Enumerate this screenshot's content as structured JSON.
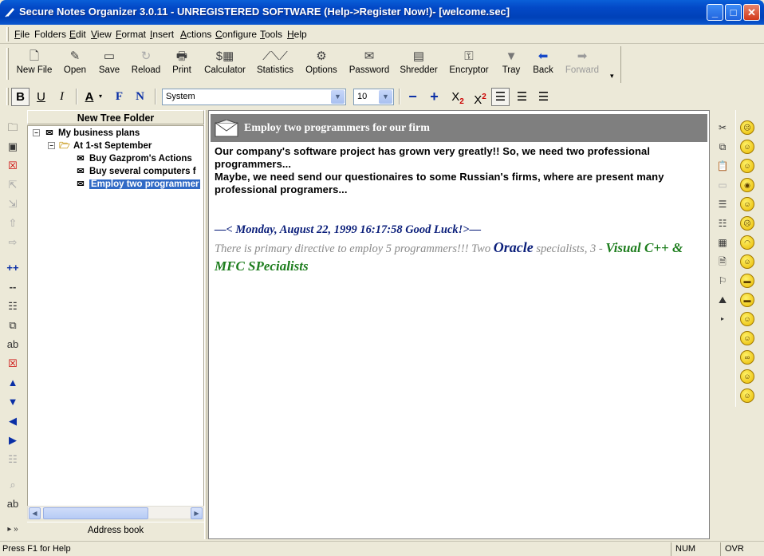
{
  "window": {
    "title": "Secure Notes Organizer 3.0.11 - UNREGISTERED SOFTWARE (Help->Register Now!)- [welcome.sec]",
    "min_label": "_",
    "max_label": "□",
    "close_label": "✕"
  },
  "menu": [
    {
      "label": "File",
      "u": "F",
      "rest": "ile"
    },
    {
      "label": "Folders",
      "u": "",
      "rest": "Folders"
    },
    {
      "label": "Edit",
      "u": "E",
      "rest": "dit"
    },
    {
      "label": "View",
      "u": "V",
      "rest": "iew"
    },
    {
      "label": "Format",
      "u": "F",
      "rest": "ormat"
    },
    {
      "label": "Insert",
      "u": "I",
      "rest": "nsert"
    },
    {
      "label": "Actions",
      "u": "A",
      "rest": "ctions"
    },
    {
      "label": "Configure",
      "u": "C",
      "rest": "onfigure"
    },
    {
      "label": "Tools",
      "u": "T",
      "rest": "ools"
    },
    {
      "label": "Help",
      "u": "H",
      "rest": "elp"
    }
  ],
  "toolbar": {
    "new_file": "New File",
    "open": "Open",
    "save": "Save",
    "reload": "Reload",
    "print": "Print",
    "calculator": "Calculator",
    "statistics": "Statistics",
    "options": "Options",
    "password": "Password",
    "shredder": "Shredder",
    "encryptor": "Encryptor",
    "tray": "Tray",
    "back": "Back",
    "forward": "Forward"
  },
  "format": {
    "bold": "B",
    "underline": "U",
    "italic": "I",
    "font_color": "A",
    "f_btn": "F",
    "n_btn": "N",
    "font_name": "System",
    "font_size": "10",
    "minus": "−",
    "plus": "+",
    "subscript": "X",
    "subscript_mark": "2",
    "superscript": "X",
    "superscript_mark": "2"
  },
  "tree": {
    "header": "New Tree Folder",
    "nodes": [
      {
        "label": "My business plans"
      },
      {
        "label": "At 1-st September"
      },
      {
        "label": "Buy Gazprom's Actions"
      },
      {
        "label": "Buy several computers f"
      },
      {
        "label": "Employ two programmer"
      }
    ],
    "footer": "Address book"
  },
  "note": {
    "title": "Employ two programmers for our firm",
    "para1": "Our company's software project has grown very greatly!! So, we need two professional programmers...",
    "para2": "Maybe, we need send our questionaires to some Russian's firms, where are present many professional programers...",
    "date_line": "—< Monday, August 22, 1999  16:17:58  Good Luck!>—",
    "directive_prefix": "There is primary directive to employ 5 programmers!!! Two ",
    "oracle": "Oracle",
    "specialists": " specialists, 3 - ",
    "visual": "Visual C++ & MFC SPecialists"
  },
  "status": {
    "message": "Press F1 for Help",
    "num": "NUM",
    "ovr": "OVR"
  },
  "colors": {
    "selection": "#316ac5",
    "note_header_bg": "#7f7f7f",
    "navy_text": "#0a1e7a",
    "green_text": "#1d7d1d"
  }
}
